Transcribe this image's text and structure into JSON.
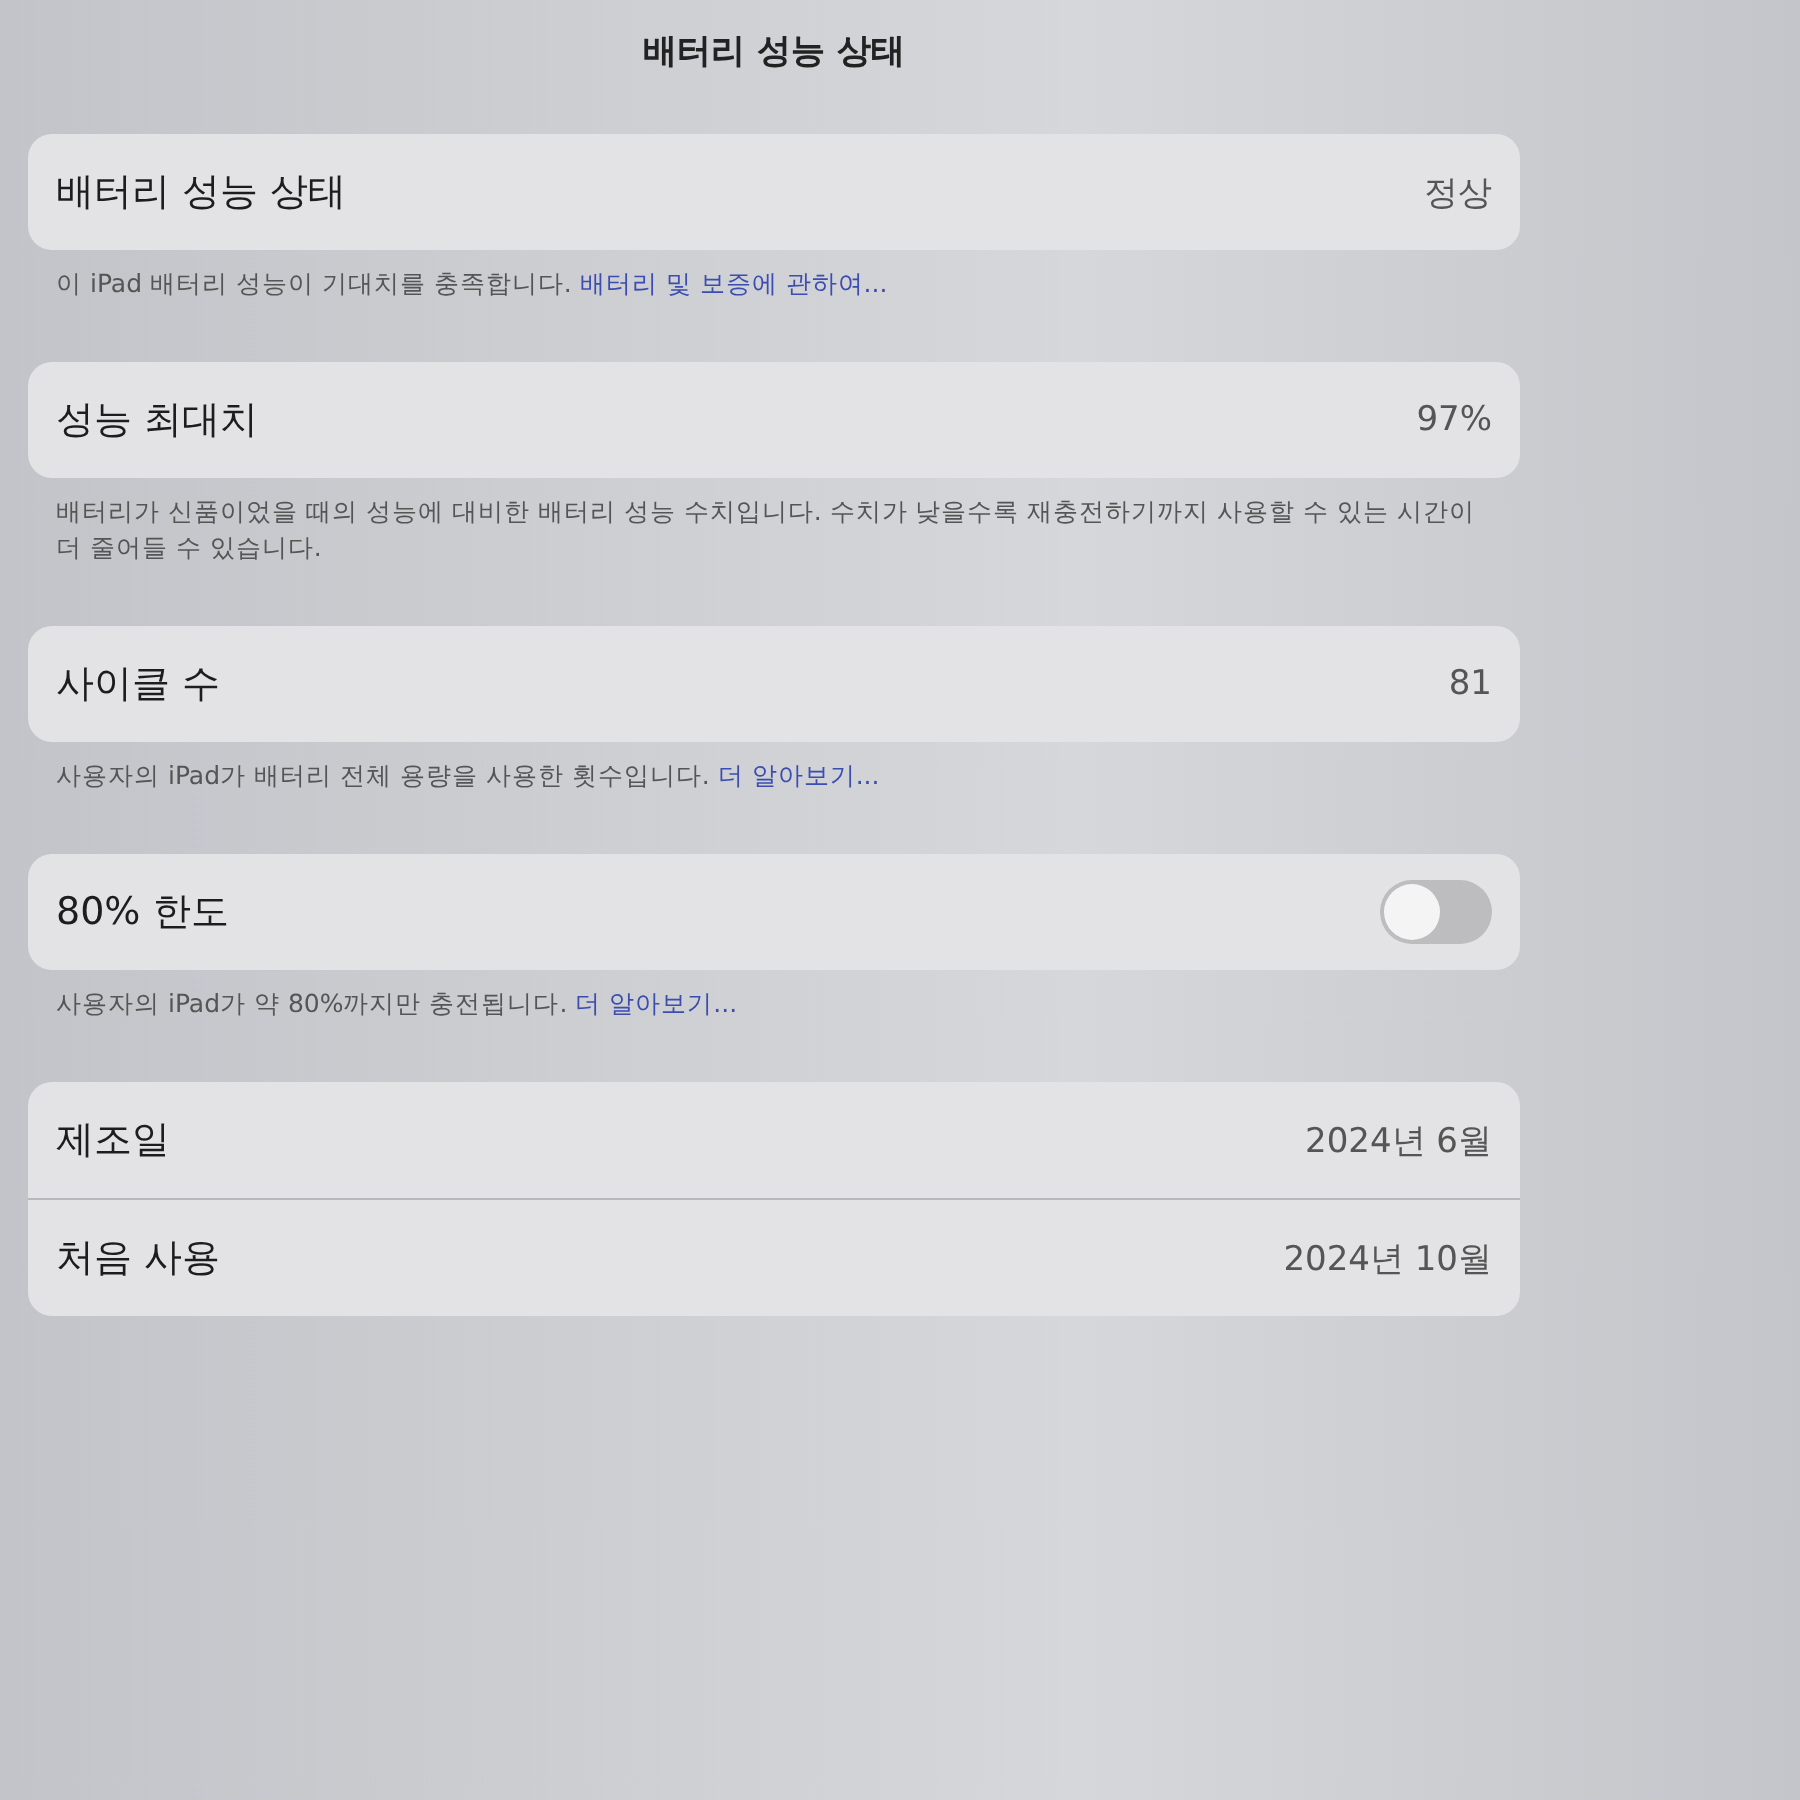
{
  "title": "배터리 성능 상태",
  "sections": [
    {
      "rows": [
        {
          "kind": "value",
          "label": "배터리 성능 상태",
          "value": "정상"
        }
      ],
      "footer": {
        "text": "이 iPad 배터리 성능이 기대치를 충족합니다.",
        "link": "배터리 및 보증에 관하여..."
      }
    },
    {
      "rows": [
        {
          "kind": "value",
          "label": "성능 최대치",
          "value": "97%"
        }
      ],
      "footer": {
        "text": "배터리가 신품이었을 때의 성능에 대비한 배터리 성능 수치입니다. 수치가 낮을수록 재충전하기까지 사용할 수 있는 시간이 더 줄어들 수 있습니다."
      }
    },
    {
      "rows": [
        {
          "kind": "value",
          "label": "사이클 수",
          "value": "81"
        }
      ],
      "footer": {
        "text": "사용자의 iPad가 배터리 전체 용량을 사용한 횟수입니다.",
        "link": "더 알아보기..."
      }
    },
    {
      "rows": [
        {
          "kind": "toggle",
          "label": "80% 한도",
          "on": false
        }
      ],
      "footer": {
        "text": "사용자의 iPad가 약 80%까지만 충전됩니다.",
        "link": "더 알아보기..."
      }
    },
    {
      "rows": [
        {
          "kind": "value",
          "label": "제조일",
          "value": "2024년 6월"
        },
        {
          "kind": "value",
          "label": "처음 사용",
          "value": "2024년 10월"
        }
      ]
    }
  ]
}
